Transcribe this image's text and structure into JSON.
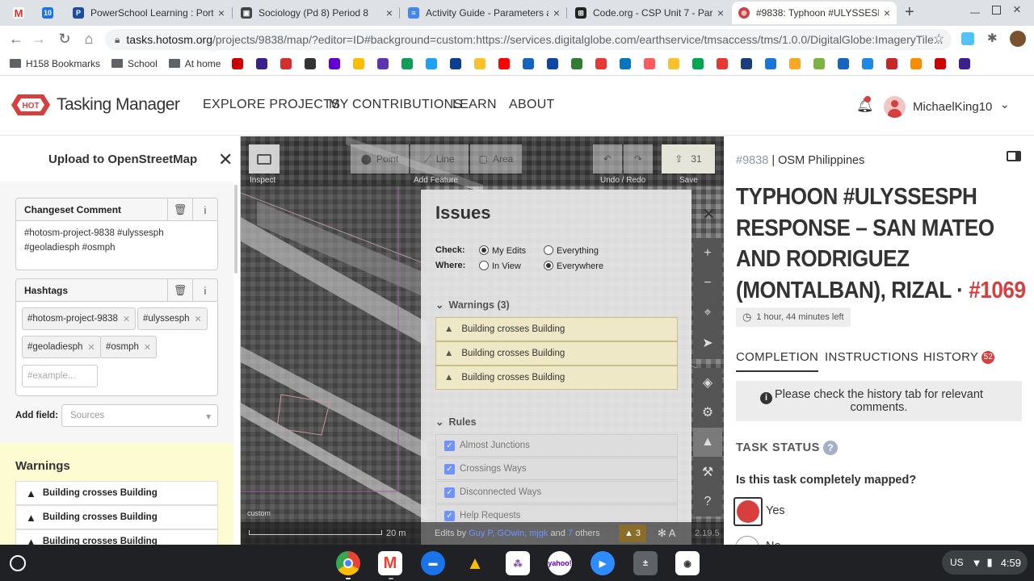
{
  "browser": {
    "tabs": [
      {
        "title": "",
        "icon": "gmail-icon"
      },
      {
        "title": "",
        "icon": "calendar-icon"
      },
      {
        "title": "PowerSchool Learning : Port",
        "icon": "powerschool-icon"
      },
      {
        "title": "Sociology (Pd 8) Period 8",
        "icon": "classroom-icon"
      },
      {
        "title": "Activity Guide - Parameters a",
        "icon": "docs-icon"
      },
      {
        "title": "Code.org - CSP Unit 7 - Paran",
        "icon": "codeorg-icon"
      },
      {
        "title": "#9838: Typhoon #ULYSSESPH",
        "icon": "hot-icon"
      }
    ],
    "new_tab": "+",
    "url_host": "tasks.hotosm.org",
    "url_path": "/projects/9838/map/?editor=ID#background=custom:https://services.digitalglobe.com/earthservice/tmsaccess/tms/1.0.0/DigitalGlobe:ImageryTile...",
    "bookmarks": [
      {
        "label": "H158 Bookmarks",
        "type": "folder"
      },
      {
        "label": "School",
        "type": "folder"
      },
      {
        "label": "At home",
        "type": "folder"
      }
    ],
    "bookmark_icon_colors": [
      "#cc0000",
      "#3b1f8c",
      "#d32f2f",
      "#333",
      "#6001d2",
      "#fbbc04",
      "#5e35b1",
      "#0f9d58",
      "#1da1f2",
      "#0b3d91",
      "#fbc02d",
      "#ff0000",
      "#1565c0",
      "#0d47a1",
      "#2e7d32",
      "#e53935",
      "#0277bd",
      "#ff5a5f",
      "#fbc02d",
      "#00a650",
      "#e53935",
      "#1a3d7c",
      "#1976d2",
      "#f9a825",
      "#7cb342",
      "#1565c0",
      "#1e88e5",
      "#c62828",
      "#fb8c00",
      "#cc0000",
      "#3b1f8c"
    ]
  },
  "tm": {
    "brand": "Tasking Manager",
    "brand_badge": "HOT",
    "nav": [
      "EXPLORE PROJECTS",
      "MY CONTRIBUTIONS",
      "LEARN",
      "ABOUT"
    ],
    "username": "MichaelKing10"
  },
  "upload": {
    "title": "Upload to OpenStreetMap",
    "changeset_label": "Changeset Comment",
    "changeset_value": "#hotosm-project-9838 #ulyssesph #geoladiesph #osmph",
    "hashtags_label": "Hashtags",
    "hashtags": [
      "#hotosm-project-9838",
      "#ulyssesph",
      "#geoladiesph",
      "#osmph"
    ],
    "hashtag_placeholder": "#example...",
    "add_field_label": "Add field:",
    "sources_placeholder": "Sources",
    "warnings_title": "Warnings",
    "warnings": [
      "Building crosses Building",
      "Building crosses Building",
      "Building crosses Building"
    ]
  },
  "editor": {
    "inspect_label": "Inspect",
    "add_feature_label": "Add Feature",
    "tools": [
      "Point",
      "Line",
      "Area"
    ],
    "undo_redo_label": "Undo / Redo",
    "save_label": "Save",
    "save_count": "31",
    "issues": {
      "title": "Issues",
      "check_label": "Check:",
      "where_label": "Where:",
      "opt_my_edits": "My Edits",
      "opt_everything": "Everything",
      "opt_in_view": "In View",
      "opt_everywhere": "Everywhere",
      "warnings_header": "Warnings (3)",
      "warnings": [
        "Building crosses Building",
        "Building crosses Building",
        "Building crosses Building"
      ],
      "rules_header": "Rules",
      "rules": [
        "Almost Junctions",
        "Crossings Ways",
        "Disconnected Ways",
        "Help Requests"
      ]
    },
    "footer": {
      "scale": "20 m",
      "edits_by_prefix": "Edits by",
      "edits_by_names": "Guy P, GOwin, mjgk",
      "edits_by_and": "and",
      "edits_by_count": "7",
      "edits_by_suffix": "others",
      "issue_count": "3",
      "version": "2.19.5",
      "custom_label": "custom"
    }
  },
  "task": {
    "project_id": "#9838",
    "org": "OSM Philippines",
    "title_main": "TYPHOON #ULYSSESPH RESPONSE – SAN MATEO AND RODRIGUEZ (MONTALBAN), RIZAL ·",
    "task_number": "#1069",
    "time_left": "1 hour, 44 minutes left",
    "tabs": [
      "COMPLETION",
      "INSTRUCTIONS",
      "HISTORY"
    ],
    "history_badge": "52",
    "notice": "Please check the history tab for relevant comments.",
    "status_title": "TASK STATUS",
    "question": "Is this task completely mapped?",
    "opt_yes": "Yes",
    "opt_no": "No"
  },
  "os": {
    "locale": "US",
    "time": "4:59"
  }
}
